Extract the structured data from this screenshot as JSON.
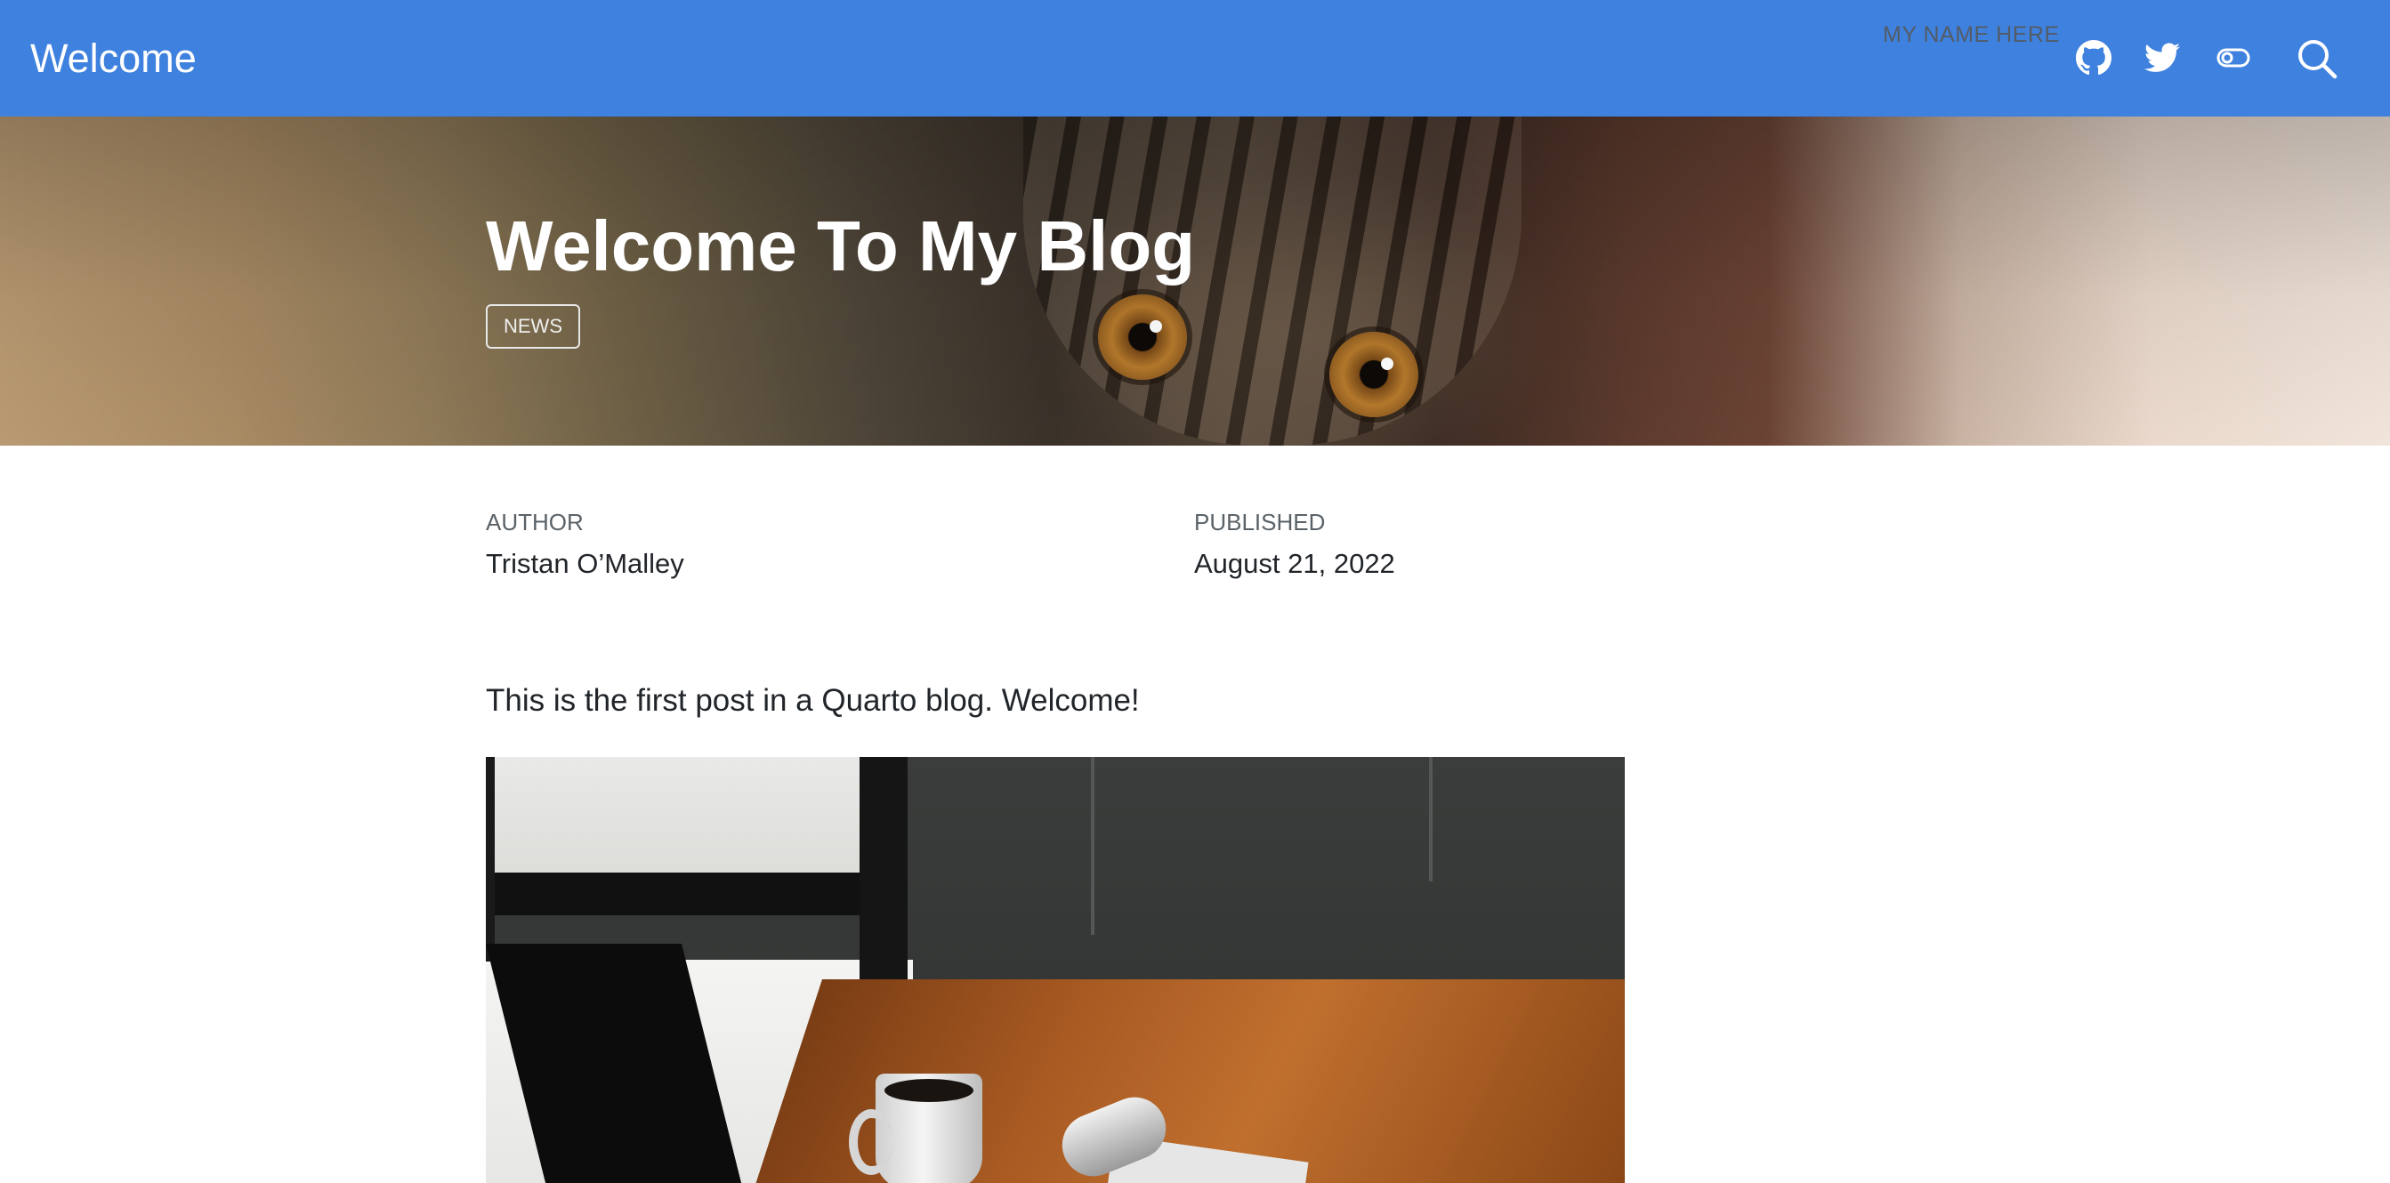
{
  "navbar": {
    "brand": "Welcome",
    "name_text": "MY NAME HERE",
    "icons": [
      "github-icon",
      "twitter-icon",
      "theme-toggle-icon",
      "search-icon"
    ],
    "background": "#3f81de"
  },
  "banner": {
    "title": "Welcome To My Blog",
    "category": "NEWS"
  },
  "meta": {
    "author_label": "AUTHOR",
    "author": "Tristan O’Malley",
    "published_label": "PUBLISHED",
    "published": "August 21, 2022"
  },
  "content": {
    "intro": "This is the first post in a Quarto blog. Welcome!"
  }
}
